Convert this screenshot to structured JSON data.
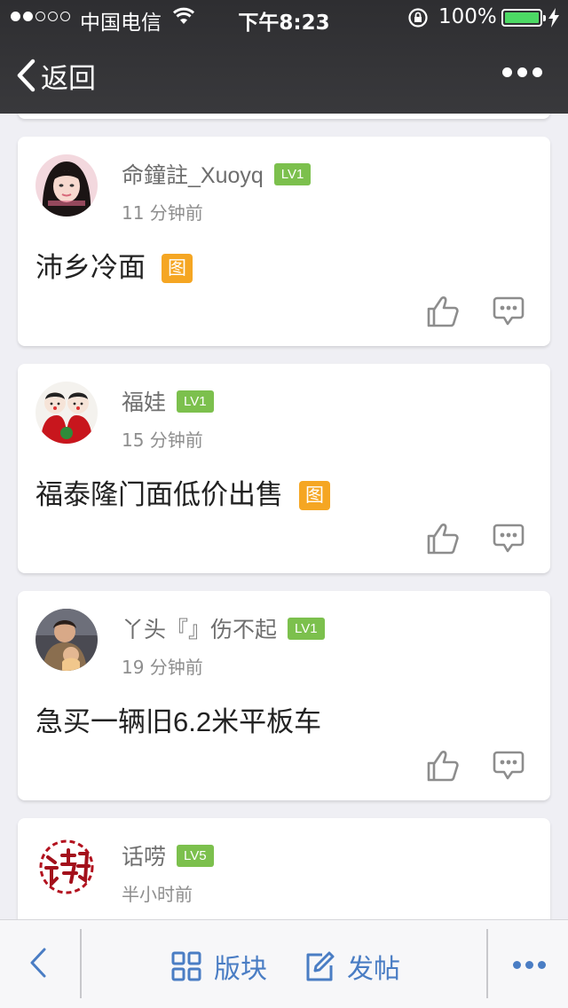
{
  "status_bar": {
    "carrier": "中国电信",
    "time": "下午8:23",
    "battery": "100%",
    "signal_bars_filled": 2,
    "signal_bars_total": 5
  },
  "nav": {
    "back_label": "返回"
  },
  "posts": [
    {
      "username": "命鐘註_Xuoyq",
      "level": "LV1",
      "time": "11 分钟前",
      "title": "沛乡冷面",
      "has_image": true,
      "image_badge": "图"
    },
    {
      "username": "福娃",
      "level": "LV1",
      "time": "15 分钟前",
      "title": "福泰隆门面低价出售",
      "has_image": true,
      "image_badge": "图"
    },
    {
      "username": "丫头『』伤不起",
      "level": "LV1",
      "time": "19 分钟前",
      "title": "急买一辆旧6.2米平板车",
      "has_image": false
    },
    {
      "username": "话唠",
      "level": "LV5",
      "time": "半小时前",
      "title": "",
      "has_image": false
    }
  ],
  "toolbar": {
    "boards_label": "版块",
    "compose_label": "发帖"
  },
  "colors": {
    "header_bg": "#333336",
    "page_bg": "#efeff4",
    "level_badge": "#7cc04d",
    "image_badge": "#f5a623",
    "toolbar_accent": "#4a7dc4",
    "battery_fill": "#4cd964"
  },
  "icons": {
    "back": "chevron-left-icon",
    "more": "more-dots-icon",
    "like": "thumbs-up-icon",
    "reply": "comment-icon",
    "boards": "grid-icon",
    "compose": "edit-icon"
  }
}
